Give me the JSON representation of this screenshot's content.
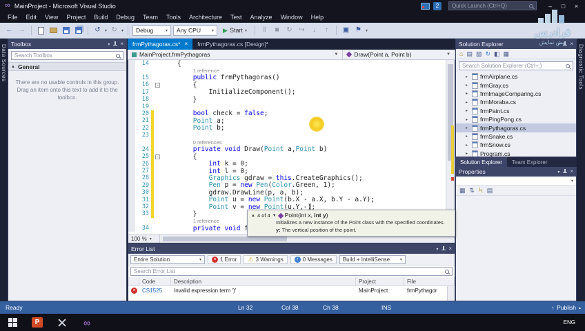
{
  "window": {
    "title": "MainProject - Microsoft Visual Studio",
    "quick_launch": "Quick Launch (Ctrl+Q)",
    "overlay_badge": "2"
  },
  "menu": {
    "items": [
      "File",
      "Edit",
      "View",
      "Project",
      "Build",
      "Debug",
      "Team",
      "Tools",
      "Architecture",
      "Test",
      "Analyze",
      "Window",
      "Help"
    ]
  },
  "toolbar": {
    "configuration": "Debug",
    "platform": "Any CPU",
    "start": "Start"
  },
  "side_strips": {
    "left": "Data Sources",
    "right": "Diagnostic Tools"
  },
  "toolbox": {
    "title": "Toolbox",
    "search_placeholder": "Search Toolbox",
    "section_label": "General",
    "empty_text": "There are no usable controls in this group. Drag an item onto this text to add it to the toolbox."
  },
  "editor": {
    "tabs": [
      {
        "label": "frmPythagoras.cs*"
      },
      {
        "label": "frmPythagoras.cs [Design]*"
      }
    ],
    "breadcrumb": {
      "type": "MainProject.frmPythagoras",
      "member": "Draw(Point a, Point b)"
    },
    "zoom": "100 %",
    "code_lines": [
      {
        "n": 14,
        "indent": 4,
        "tokens": [
          [
            "p",
            "{"
          ]
        ]
      },
      {
        "ann": "1 reference",
        "indent": 8
      },
      {
        "n": 15,
        "indent": 8,
        "tokens": [
          [
            "k",
            "public"
          ],
          [
            "p",
            " frmPythagoras()"
          ]
        ]
      },
      {
        "n": 16,
        "indent": 8,
        "fold": true,
        "tokens": [
          [
            "p",
            "{"
          ]
        ]
      },
      {
        "n": 17,
        "indent": 12,
        "tokens": [
          [
            "p",
            "InitializeComponent();"
          ]
        ]
      },
      {
        "n": 18,
        "indent": 8,
        "tokens": [
          [
            "p",
            "}"
          ]
        ]
      },
      {
        "n": 19,
        "tokens": []
      },
      {
        "n": 20,
        "indent": 8,
        "mod": true,
        "tokens": [
          [
            "k",
            "bool"
          ],
          [
            "p",
            " check = "
          ],
          [
            "k",
            "false"
          ],
          [
            "p",
            ";"
          ]
        ]
      },
      {
        "n": 21,
        "indent": 8,
        "mod": true,
        "tokens": [
          [
            "t",
            "Point"
          ],
          [
            "p",
            " a;"
          ]
        ]
      },
      {
        "n": 22,
        "indent": 8,
        "mod": true,
        "tokens": [
          [
            "t",
            "Point"
          ],
          [
            "p",
            " b;"
          ]
        ]
      },
      {
        "n": 23,
        "mod": true,
        "tokens": []
      },
      {
        "ann": "0 references",
        "indent": 8,
        "mod": true
      },
      {
        "n": 24,
        "indent": 8,
        "mod": true,
        "tokens": [
          [
            "k",
            "private"
          ],
          [
            "p",
            " "
          ],
          [
            "k",
            "void"
          ],
          [
            "p",
            " Draw("
          ],
          [
            "t",
            "Point"
          ],
          [
            "p",
            " a,"
          ],
          [
            "t",
            "Point"
          ],
          [
            "p",
            " b)"
          ]
        ]
      },
      {
        "n": 25,
        "indent": 8,
        "mod": true,
        "fold": true,
        "tokens": [
          [
            "p",
            "{"
          ]
        ]
      },
      {
        "n": 26,
        "indent": 12,
        "mod": true,
        "tokens": [
          [
            "k",
            "int"
          ],
          [
            "p",
            " k = 0;"
          ]
        ]
      },
      {
        "n": 27,
        "indent": 12,
        "mod": true,
        "tokens": [
          [
            "k",
            "int"
          ],
          [
            "p",
            " l = 0;"
          ]
        ]
      },
      {
        "n": 28,
        "indent": 12,
        "mod": true,
        "tokens": [
          [
            "t",
            "Graphics"
          ],
          [
            "p",
            " gdraw = "
          ],
          [
            "k",
            "this"
          ],
          [
            "p",
            ".CreateGraphics();"
          ]
        ]
      },
      {
        "n": 29,
        "indent": 12,
        "mod": true,
        "tokens": [
          [
            "t",
            "Pen"
          ],
          [
            "p",
            " p = "
          ],
          [
            "k",
            "new"
          ],
          [
            "p",
            " "
          ],
          [
            "t",
            "Pen"
          ],
          [
            "p",
            "("
          ],
          [
            "t",
            "Color"
          ],
          [
            "p",
            ".Green, 1);"
          ]
        ]
      },
      {
        "n": 30,
        "indent": 12,
        "mod": true,
        "tokens": [
          [
            "p",
            "gdraw.DrawLine(p, a, b);"
          ]
        ]
      },
      {
        "n": 31,
        "indent": 12,
        "mod": true,
        "tokens": [
          [
            "t",
            "Point"
          ],
          [
            "p",
            " u = "
          ],
          [
            "k",
            "new"
          ],
          [
            "p",
            " "
          ],
          [
            "t",
            "Point"
          ],
          [
            "p",
            "(b.X - a.X, b.Y - a.Y);"
          ]
        ]
      },
      {
        "n": 32,
        "indent": 12,
        "mod": true,
        "tokens": [
          [
            "t",
            "Point"
          ],
          [
            "p",
            " v = "
          ],
          [
            "k",
            "new"
          ],
          [
            "p",
            " "
          ],
          [
            "t",
            "Point"
          ],
          [
            "p",
            "(u.Y,-);"
          ]
        ]
      },
      {
        "n": 33,
        "indent": 8,
        "mod": true,
        "tokens": [
          [
            "p",
            "}"
          ]
        ]
      },
      {
        "ann": "1 reference",
        "indent": 8
      },
      {
        "n": 34,
        "indent": 8,
        "tokens": [
          [
            "k",
            "private"
          ],
          [
            "p",
            " "
          ],
          [
            "k",
            "void"
          ],
          [
            "p",
            " f"
          ]
        ]
      }
    ],
    "param_tip": {
      "pager": "4 of 4",
      "sig_before": "Point(int x, ",
      "sig_param": "int y",
      "sig_after": ")",
      "summary": "Initializes a new instance of the Point class with the specified coordinates.",
      "param_label": "y:",
      "param_doc": "The vertical position of the point."
    }
  },
  "solution_explorer": {
    "title": "Solution Explorer",
    "search_placeholder": "Search Solution Explorer (Ctrl+;)",
    "items": [
      {
        "label": "frmAirplane.cs"
      },
      {
        "label": "frmGray.cs"
      },
      {
        "label": "frmImageComparing.cs"
      },
      {
        "label": "frmMoraba.cs"
      },
      {
        "label": "frmPaint.cs"
      },
      {
        "label": "frmPingPong.cs"
      },
      {
        "label": "frmPythagoras.cs",
        "selected": true
      },
      {
        "label": "frmSnake.cs"
      },
      {
        "label": "frmSnow.cs"
      },
      {
        "label": "Program.cs"
      }
    ],
    "tabs": [
      "Solution Explorer",
      "Team Explorer"
    ]
  },
  "properties_panel": {
    "title": "Properties"
  },
  "error_list": {
    "title": "Error List",
    "scope": "Entire Solution",
    "errors": "1 Error",
    "warnings": "3 Warnings",
    "messages": "0 Messages",
    "source_filter": "Build + IntelliSense",
    "search_placeholder": "Search Error List",
    "columns": [
      "Code",
      "Description",
      "Project",
      "File"
    ],
    "rows": [
      {
        "code": "CS1525",
        "description": "Invalid expression term ')'",
        "project": "MainProject",
        "file": "frmPythagor"
      }
    ]
  },
  "status_bar": {
    "state": "Ready",
    "ln": "Ln 32",
    "col": "Col 38",
    "ch": "Ch 38",
    "mode": "INS",
    "publish": "Publish"
  },
  "taskbar": {
    "powerpoint_letter": "P",
    "language": "ENG"
  },
  "watermark": {
    "brand": "فرادرس",
    "subtitle": "پیش نمایش"
  }
}
